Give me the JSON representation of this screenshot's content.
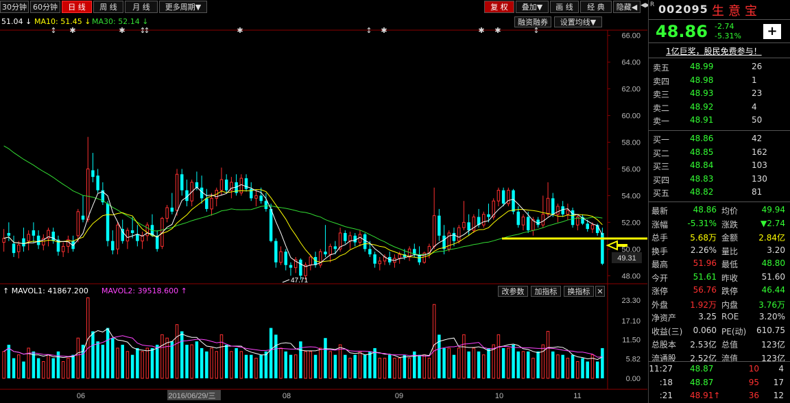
{
  "toolbar": {
    "tabs": [
      "30分钟",
      "60分钟",
      "日 线",
      "周 线",
      "月 线",
      "更多周期▼"
    ],
    "active_tab": "日 线",
    "right": [
      "复 权",
      "叠加▼",
      "画 线",
      "经 典",
      "隐藏◀"
    ],
    "arrows": "◀▶"
  },
  "ma_legend": {
    "ma5": "51.04 ↓",
    "ma10": "MA10: 51.45 ↓",
    "ma30": "MA30: 52.14 ↓"
  },
  "chart_buttons": {
    "margin": "融资融券",
    "ma_settings": "设置均线▼"
  },
  "vol_legend": {
    "mavol1": "↑ MAVOL1: 41867.200",
    "mavol2": "MAVOL2: 39518.600 ↑",
    "btn1": "改参数",
    "btn2": "加指标",
    "btn3": "换指标",
    "close": "✕"
  },
  "price_axis": [
    "66.00",
    "64.00",
    "62.00",
    "60.00",
    "58.00",
    "56.00",
    "54.00",
    "52.00",
    "50.00",
    "48.00"
  ],
  "vol_axis": [
    "23.30",
    "17.10",
    "11.50",
    "5.82",
    "0.00"
  ],
  "price_tag": "49.31",
  "low_label": "47.71",
  "date_axis": [
    "06",
    "2016/06/29/三",
    "08",
    "09",
    "10",
    "11"
  ],
  "colors": {
    "up": "#ff3030",
    "down": "#00ffff",
    "ma5": "#ffffff",
    "ma10": "#ffff00",
    "ma30": "#33dd33",
    "accent": "#ffff00"
  },
  "chart_data": {
    "type": "candlestick",
    "ylim": [
      47.5,
      66.5
    ],
    "candles": [
      [
        50.5,
        51.5,
        49.8,
        50.8
      ],
      [
        51.2,
        52.0,
        50.6,
        51.0
      ],
      [
        50.4,
        51.0,
        49.4,
        49.7
      ],
      [
        49.8,
        50.6,
        49.3,
        50.3
      ],
      [
        50.8,
        51.6,
        49.8,
        50.2
      ],
      [
        50.6,
        51.4,
        49.9,
        51.1
      ],
      [
        51.4,
        52.0,
        50.5,
        51.0
      ],
      [
        51.0,
        51.4,
        50.0,
        50.3
      ],
      [
        50.3,
        51.1,
        49.9,
        50.8
      ],
      [
        50.8,
        51.6,
        50.2,
        51.4
      ],
      [
        51.3,
        51.6,
        50.4,
        50.6
      ],
      [
        50.7,
        51.0,
        49.5,
        49.8
      ],
      [
        49.8,
        50.5,
        49.4,
        50.2
      ],
      [
        50.2,
        51.0,
        49.7,
        50.7
      ],
      [
        50.6,
        51.0,
        49.8,
        50.0
      ],
      [
        51.0,
        53.0,
        50.5,
        52.8
      ],
      [
        52.5,
        54.0,
        52.0,
        52.2
      ],
      [
        52.2,
        58.4,
        52.0,
        56.0
      ],
      [
        55.9,
        57.2,
        55.0,
        55.4
      ],
      [
        55.5,
        56.0,
        54.2,
        54.4
      ],
      [
        54.4,
        55.0,
        53.3,
        53.5
      ],
      [
        53.4,
        53.6,
        50.2,
        50.6
      ],
      [
        50.6,
        51.4,
        49.6,
        49.9
      ],
      [
        50.0,
        52.0,
        49.6,
        51.8
      ],
      [
        51.5,
        52.2,
        50.4,
        50.6
      ],
      [
        50.6,
        51.6,
        50.0,
        51.4
      ],
      [
        51.4,
        52.4,
        50.8,
        51.2
      ],
      [
        51.1,
        51.8,
        50.2,
        50.6
      ],
      [
        50.6,
        51.3,
        50.0,
        51.0
      ],
      [
        51.0,
        52.0,
        50.6,
        51.8
      ],
      [
        51.8,
        52.6,
        50.9,
        51.0
      ],
      [
        51.0,
        51.4,
        49.8,
        50.0
      ],
      [
        50.2,
        52.4,
        50.0,
        52.3
      ],
      [
        52.3,
        53.3,
        52.0,
        53.1
      ],
      [
        53.1,
        54.2,
        52.6,
        52.8
      ],
      [
        52.9,
        56.0,
        52.5,
        55.6
      ],
      [
        55.6,
        56.0,
        54.0,
        54.4
      ],
      [
        54.4,
        55.2,
        53.2,
        53.6
      ],
      [
        53.6,
        55.2,
        53.2,
        55.0
      ],
      [
        55.0,
        55.8,
        54.4,
        54.6
      ],
      [
        54.6,
        55.5,
        53.4,
        53.8
      ],
      [
        53.8,
        54.5,
        52.8,
        53.0
      ],
      [
        53.0,
        54.2,
        52.5,
        53.8
      ],
      [
        53.8,
        54.6,
        53.2,
        54.4
      ],
      [
        54.4,
        56.1,
        54.0,
        55.2
      ],
      [
        55.2,
        55.6,
        54.2,
        54.4
      ],
      [
        54.4,
        55.4,
        53.8,
        55.0
      ],
      [
        55.0,
        55.6,
        54.0,
        54.2
      ],
      [
        54.2,
        55.6,
        54.0,
        55.3
      ],
      [
        55.3,
        55.6,
        54.3,
        54.5
      ],
      [
        54.5,
        55.0,
        53.6,
        53.8
      ],
      [
        53.8,
        54.4,
        53.2,
        54.0
      ],
      [
        54.0,
        54.6,
        53.4,
        53.6
      ],
      [
        53.6,
        54.2,
        52.8,
        53.0
      ],
      [
        53.0,
        53.4,
        50.5,
        50.6
      ],
      [
        50.6,
        50.8,
        48.6,
        49.0
      ],
      [
        49.0,
        50.2,
        48.8,
        49.8
      ],
      [
        49.8,
        50.0,
        48.4,
        48.8
      ],
      [
        48.8,
        49.0,
        48.0,
        48.6
      ],
      [
        48.6,
        49.4,
        48.2,
        49.2
      ],
      [
        49.2,
        49.3,
        47.7,
        48.0
      ],
      [
        48.0,
        49.0,
        47.7,
        48.8
      ],
      [
        48.8,
        49.6,
        48.4,
        49.4
      ],
      [
        49.4,
        49.8,
        48.6,
        48.8
      ],
      [
        48.8,
        50.0,
        48.6,
        49.8
      ],
      [
        49.8,
        51.8,
        49.4,
        49.6
      ],
      [
        49.6,
        50.4,
        49.0,
        50.2
      ],
      [
        50.2,
        50.6,
        49.6,
        50.0
      ],
      [
        50.0,
        51.6,
        49.8,
        51.2
      ],
      [
        51.2,
        51.4,
        50.4,
        50.6
      ],
      [
        50.6,
        51.3,
        50.0,
        51.0
      ],
      [
        51.0,
        51.2,
        50.2,
        50.5
      ],
      [
        50.5,
        51.4,
        50.2,
        51.1
      ],
      [
        51.1,
        51.2,
        49.8,
        50.0
      ],
      [
        50.0,
        50.6,
        49.4,
        49.6
      ],
      [
        49.6,
        49.8,
        48.6,
        48.9
      ],
      [
        48.9,
        49.4,
        48.4,
        49.1
      ],
      [
        49.1,
        49.6,
        48.8,
        49.4
      ],
      [
        49.4,
        49.8,
        48.8,
        49.0
      ],
      [
        49.0,
        49.6,
        48.6,
        49.3
      ],
      [
        49.3,
        49.8,
        48.9,
        49.6
      ],
      [
        49.6,
        50.0,
        49.2,
        49.4
      ],
      [
        49.4,
        50.2,
        49.1,
        50.0
      ],
      [
        50.0,
        50.4,
        49.4,
        49.6
      ],
      [
        49.6,
        50.2,
        48.8,
        49.0
      ],
      [
        49.0,
        49.8,
        48.9,
        49.7
      ],
      [
        49.7,
        50.4,
        49.3,
        50.2
      ],
      [
        50.2,
        54.6,
        50.0,
        52.5
      ],
      [
        52.5,
        53.0,
        50.6,
        51.0
      ],
      [
        51.0,
        51.8,
        49.6,
        50.0
      ],
      [
        50.0,
        51.4,
        49.8,
        51.2
      ],
      [
        51.2,
        51.6,
        50.2,
        50.6
      ],
      [
        50.6,
        51.8,
        50.4,
        51.6
      ],
      [
        51.6,
        53.6,
        51.4,
        52.0
      ],
      [
        52.0,
        52.6,
        51.0,
        51.4
      ],
      [
        51.4,
        52.6,
        51.2,
        52.4
      ],
      [
        52.4,
        53.0,
        51.6,
        51.8
      ],
      [
        51.8,
        52.8,
        51.6,
        52.6
      ],
      [
        52.6,
        53.4,
        52.0,
        52.4
      ],
      [
        52.4,
        53.8,
        52.2,
        53.6
      ],
      [
        53.6,
        54.6,
        53.2,
        54.4
      ],
      [
        54.4,
        54.6,
        53.2,
        53.4
      ],
      [
        53.4,
        54.6,
        53.2,
        54.4
      ],
      [
        54.4,
        54.5,
        52.6,
        52.8
      ],
      [
        52.8,
        53.2,
        51.6,
        51.8
      ],
      [
        51.8,
        52.6,
        51.4,
        52.4
      ],
      [
        52.4,
        52.8,
        51.2,
        51.4
      ],
      [
        51.4,
        52.4,
        51.0,
        52.2
      ],
      [
        52.2,
        52.4,
        51.6,
        51.8
      ],
      [
        51.8,
        54.0,
        51.6,
        52.6
      ],
      [
        52.6,
        55.0,
        52.4,
        53.8
      ],
      [
        53.8,
        54.2,
        52.4,
        52.6
      ],
      [
        52.6,
        53.4,
        52.0,
        53.2
      ],
      [
        53.2,
        53.6,
        52.4,
        52.6
      ],
      [
        52.6,
        53.4,
        52.2,
        52.9
      ],
      [
        52.9,
        53.1,
        51.6,
        51.8
      ],
      [
        51.8,
        52.6,
        51.4,
        52.4
      ],
      [
        52.4,
        52.6,
        51.8,
        51.9
      ],
      [
        51.9,
        52.2,
        51.3,
        51.5
      ],
      [
        51.5,
        52.0,
        51.2,
        51.8
      ],
      [
        51.8,
        51.9,
        51.0,
        51.2
      ],
      [
        51.2,
        51.6,
        48.8,
        48.9
      ]
    ],
    "volume": [
      8,
      10,
      6,
      7,
      5,
      9,
      8,
      6,
      5,
      7,
      6,
      8,
      5,
      6,
      7,
      12,
      10,
      24,
      14,
      11,
      10,
      15,
      12,
      9,
      10,
      8,
      7,
      9,
      8,
      9,
      9,
      10,
      13,
      12,
      11,
      16,
      14,
      10,
      10,
      11,
      9,
      8,
      9,
      8,
      13,
      10,
      8,
      9,
      8,
      7,
      7,
      6,
      7,
      8,
      15,
      13,
      9,
      8,
      7,
      7,
      11,
      8,
      8,
      7,
      9,
      12,
      8,
      7,
      10,
      7,
      6,
      7,
      8,
      7,
      8,
      9,
      6,
      6,
      7,
      6,
      6,
      7,
      6,
      8,
      7,
      7,
      6,
      22,
      13,
      9,
      9,
      7,
      9,
      13,
      8,
      9,
      8,
      7,
      9,
      10,
      13,
      9,
      9,
      10,
      8,
      8,
      8,
      6,
      8,
      10,
      14,
      8,
      7,
      7,
      6,
      7,
      5,
      6,
      5,
      7,
      5,
      9
    ]
  },
  "right_panel": {
    "code": "002095",
    "name": "生意宝",
    "price": "48.86",
    "change": "-2.74",
    "change_pct": "-5.31%",
    "plus": "+",
    "ad": "1亿巨奖，股民免费参与！",
    "asks": [
      {
        "label": "卖五",
        "price": "48.99",
        "vol": "26"
      },
      {
        "label": "卖四",
        "price": "48.98",
        "vol": "1"
      },
      {
        "label": "卖三",
        "price": "48.93",
        "vol": "23"
      },
      {
        "label": "卖二",
        "price": "48.92",
        "vol": "4"
      },
      {
        "label": "卖一",
        "price": "48.91",
        "vol": "50"
      }
    ],
    "bids": [
      {
        "label": "买一",
        "price": "48.86",
        "vol": "42"
      },
      {
        "label": "买二",
        "price": "48.85",
        "vol": "162"
      },
      {
        "label": "买三",
        "price": "48.84",
        "vol": "103"
      },
      {
        "label": "买四",
        "price": "48.83",
        "vol": "130"
      },
      {
        "label": "买五",
        "price": "48.82",
        "vol": "81"
      }
    ],
    "stats": [
      {
        "l1": "最新",
        "v1": "48.86",
        "c1": "grn",
        "l2": "均价",
        "v2": "49.94",
        "c2": "grn"
      },
      {
        "l1": "涨幅",
        "v1": "-5.31%",
        "c1": "grn",
        "l2": "涨跌",
        "v2": "▼2.74",
        "c2": "grn"
      },
      {
        "l1": "总手",
        "v1": "5.68万",
        "c1": "yel",
        "l2": "金额",
        "v2": "2.84亿",
        "c2": "yel"
      },
      {
        "l1": "换手",
        "v1": "2.26%",
        "c1": "wht",
        "l2": "量比",
        "v2": "3.20",
        "c2": "wht"
      },
      {
        "l1": "最高",
        "v1": "51.96",
        "c1": "red",
        "l2": "最低",
        "v2": "48.80",
        "c2": "grn"
      },
      {
        "l1": "今开",
        "v1": "51.61",
        "c1": "grn",
        "l2": "昨收",
        "v2": "51.60",
        "c2": "wht"
      },
      {
        "l1": "涨停",
        "v1": "56.76",
        "c1": "red",
        "l2": "跌停",
        "v2": "46.44",
        "c2": "grn"
      },
      {
        "l1": "外盘",
        "v1": "1.92万",
        "c1": "red",
        "l2": "内盘",
        "v2": "3.76万",
        "c2": "grn"
      },
      {
        "l1": "净资产",
        "v1": "3.25",
        "c1": "wht",
        "l2": "ROE",
        "v2": "3.20%",
        "c2": "wht"
      },
      {
        "l1": "收益(三)",
        "v1": "0.060",
        "c1": "wht",
        "l2": "PE(动)",
        "v2": "610.75",
        "c2": "wht"
      },
      {
        "l1": "总股本",
        "v1": "2.53亿",
        "c1": "wht",
        "l2": "总值",
        "v2": "123亿",
        "c2": "wht"
      },
      {
        "l1": "流通股",
        "v1": "2.52亿",
        "c1": "wht",
        "l2": "流值",
        "v2": "123亿",
        "c2": "wht"
      }
    ],
    "ticks": [
      {
        "time": "11:27",
        "price": "48.87",
        "vol": "10",
        "n": "4",
        "vc": "red"
      },
      {
        "time": ":18",
        "price": "48.87",
        "vol": "95",
        "n": "17",
        "vc": "red"
      },
      {
        "time": ":21",
        "price": "48.91↑",
        "vol": "36",
        "n": "12",
        "vc": "red"
      }
    ]
  }
}
